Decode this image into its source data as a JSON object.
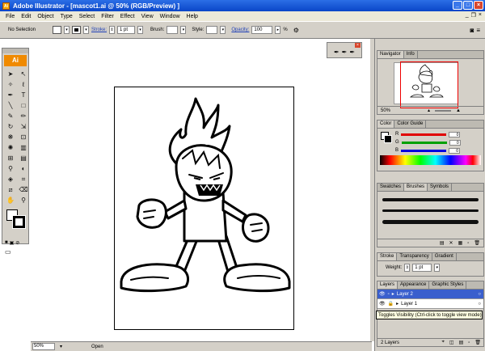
{
  "window": {
    "title": "Adobe Illustrator - [mascot1.ai @ 50% (RGB/Preview) ]",
    "app_icon": "Ai"
  },
  "menu": [
    "File",
    "Edit",
    "Object",
    "Type",
    "Select",
    "Filter",
    "Effect",
    "View",
    "Window",
    "Help"
  ],
  "control": {
    "selection": "No Selection",
    "stroke_label": "Stroke:",
    "stroke_weight": "1 pt",
    "brush_label": "Brush:",
    "style_label": "Style:",
    "opacity_label": "Opacity:",
    "opacity_value": "100",
    "percent": "%"
  },
  "toolbox": {
    "logo": "Ai"
  },
  "status": {
    "zoom": "50%",
    "state": "Open"
  },
  "navigator": {
    "tabs": [
      "Navigator",
      "Info"
    ],
    "zoom": "50%"
  },
  "color": {
    "tabs": [
      "Color",
      "Color Guide"
    ],
    "channels": [
      {
        "label": "R",
        "value": "0",
        "color": "#e00000"
      },
      {
        "label": "G",
        "value": "0",
        "color": "#00a000"
      },
      {
        "label": "B",
        "value": "0",
        "color": "#0000e0"
      }
    ]
  },
  "brushes": {
    "tabs": [
      "Swatches",
      "Brushes",
      "Symbols"
    ]
  },
  "stroke": {
    "tabs": [
      "Stroke",
      "Transparency",
      "Gradient"
    ],
    "weight_label": "Weight:",
    "weight_value": "1 pt"
  },
  "layers": {
    "tabs": [
      "Layers",
      "Appearance",
      "Graphic Styles"
    ],
    "rows": [
      {
        "name": "Layer 2"
      },
      {
        "name": "Layer 1"
      }
    ],
    "count": "2 Layers"
  },
  "tooltip": "Toggles Visibility (Ctrl-click to toggle view mode)",
  "colors": {
    "accent": "#3a5fcd",
    "chrome": "#d4d0c8",
    "title_bar": "#0a46c8"
  }
}
